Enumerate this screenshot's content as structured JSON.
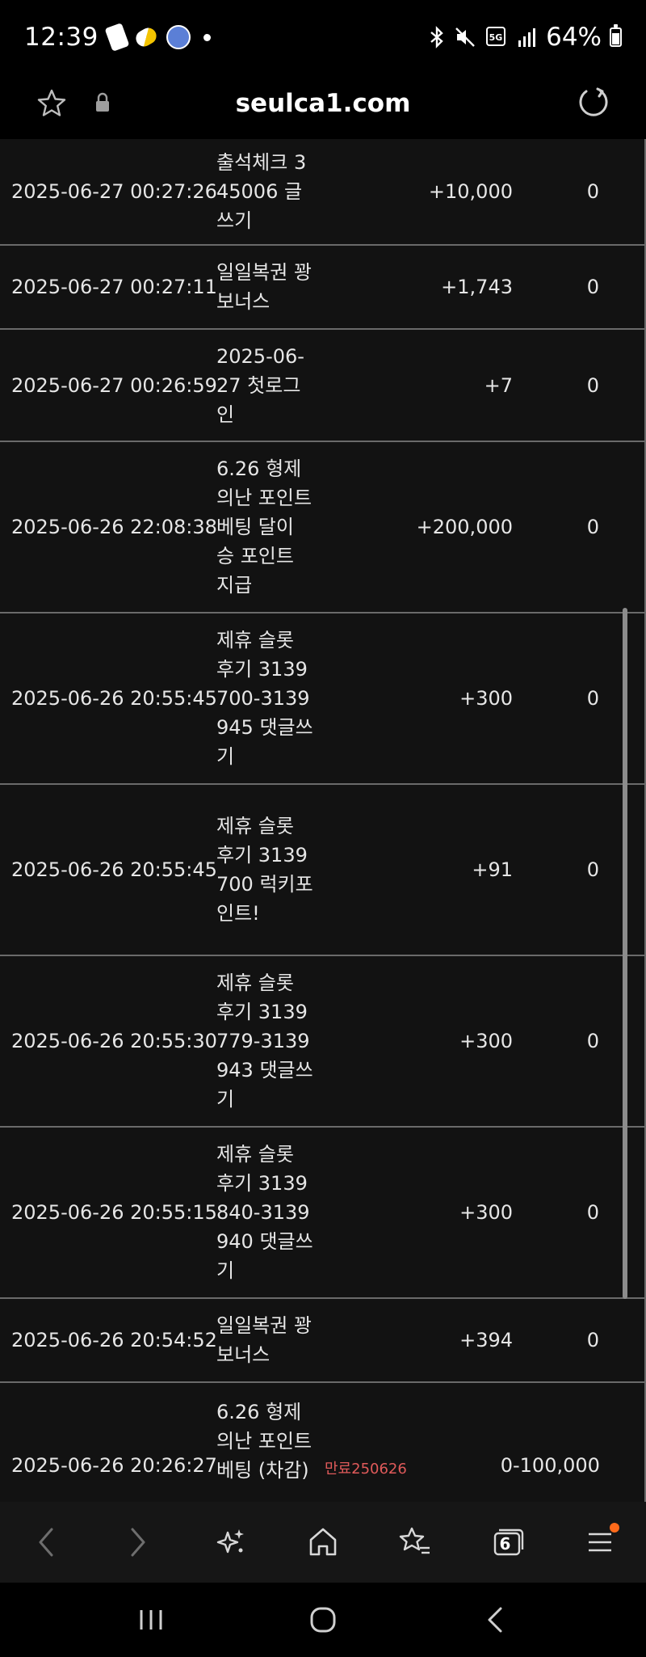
{
  "status_bar": {
    "time": "12:39",
    "battery": "64%",
    "signal_label": "5G"
  },
  "browser": {
    "url": "seulca1.com",
    "tabs_count": "6"
  },
  "rows": [
    {
      "date": "2025-06-27 00:27:26",
      "desc": "출석체크 345006 글쓰기",
      "note": "",
      "amount": "+10,000",
      "remain": "0"
    },
    {
      "date": "2025-06-27 00:27:11",
      "desc": "일일복권 꽝 보너스",
      "note": "",
      "amount": "+1,743",
      "remain": "0"
    },
    {
      "date": "2025-06-27 00:26:59",
      "desc": "2025-06-27 첫로그인",
      "note": "",
      "amount": "+7",
      "remain": "0"
    },
    {
      "date": "2025-06-26 22:08:38",
      "desc": "6.26 형제의난 포인트베팅 달이 승 포인트 지급",
      "note": "",
      "amount": "+200,000",
      "remain": "0"
    },
    {
      "date": "2025-06-26 20:55:45",
      "desc": "제휴 슬롯 후기 3139700-3139945 댓글쓰기",
      "note": "",
      "amount": "+300",
      "remain": "0"
    },
    {
      "date": "2025-06-26 20:55:45",
      "desc": "제휴 슬롯 후기 3139700 럭키포인트!",
      "note": "",
      "amount": "+91",
      "remain": "0"
    },
    {
      "date": "2025-06-26 20:55:30",
      "desc": "제휴 슬롯 후기 3139779-3139943 댓글쓰기",
      "note": "",
      "amount": "+300",
      "remain": "0"
    },
    {
      "date": "2025-06-26 20:55:15",
      "desc": "제휴 슬롯 후기 3139840-3139940 댓글쓰기",
      "note": "",
      "amount": "+300",
      "remain": "0"
    },
    {
      "date": "2025-06-26 20:54:52",
      "desc": "일일복권 꽝 보너스",
      "note": "",
      "amount": "+394",
      "remain": "0"
    },
    {
      "date": "2025-06-26 20:26:27",
      "desc": "6.26 형제의난 포인트베팅 (차감)",
      "note": "만료250626",
      "amount": "0",
      "remain": "-100,000"
    }
  ]
}
